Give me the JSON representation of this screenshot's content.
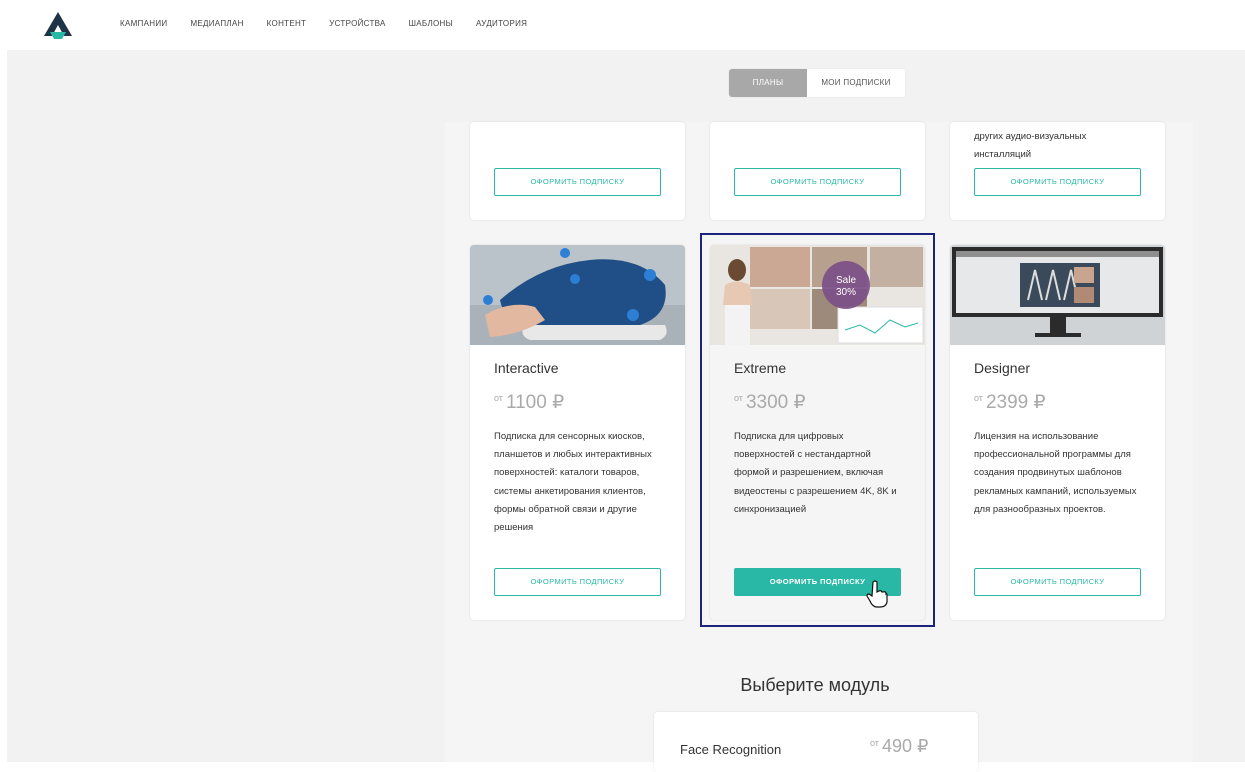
{
  "nav": {
    "items": [
      "КАМПАНИИ",
      "МЕДИАПЛАН",
      "КОНТЕНТ",
      "УСТРОЙСТВА",
      "ШАБЛОНЫ",
      "АУДИТОРИЯ"
    ]
  },
  "tabs": {
    "plans": "ПЛАНЫ",
    "my_subscriptions": "МОИ ПОДПИСКИ"
  },
  "top_cards": [
    {
      "text": "",
      "button": "ОФОРМИТЬ ПОДПИСКУ"
    },
    {
      "text": "",
      "button": "ОФОРМИТЬ ПОДПИСКУ"
    },
    {
      "text": "других аудио-визуальных инсталляций",
      "button": "ОФОРМИТЬ ПОДПИСКУ"
    }
  ],
  "plans": [
    {
      "title": "Interactive",
      "price_prefix": "от",
      "price": "1100 ₽",
      "description": "Подписка для сенсорных киосков, планшетов и любых интерактивных поверхностей: каталоги товаров, системы анкетирования клиентов, формы обратной связи и другие решения",
      "button": "ОФОРМИТЬ ПОДПИСКУ",
      "image_icon": "sneaker-touch-image"
    },
    {
      "title": "Extreme",
      "price_prefix": "от",
      "price": "3300 ₽",
      "description": "Подписка для цифровых поверхностей с нестандартной формой и разрешением, включая видеостены с разрешением 4K, 8K и синхронизацией",
      "button": "ОФОРМИТЬ ПОДПИСКУ",
      "image_icon": "videowall-image",
      "sale_badge_line1": "Sale",
      "sale_badge_line2": "30%"
    },
    {
      "title": "Designer",
      "price_prefix": "от",
      "price": "2399 ₽",
      "description": "Лицензия на использование профессиональной программы для создания продвинутых шаблонов рекламных кампаний, используемых для разнообразных проектов.",
      "button": "ОФОРМИТЬ ПОДПИСКУ",
      "image_icon": "monitor-software-image"
    }
  ],
  "modules": {
    "title": "Выберите модуль",
    "items": [
      {
        "name": "Face Recognition",
        "price_prefix": "от",
        "price": "490 ₽"
      }
    ]
  },
  "colors": {
    "accent": "#2ab8a6",
    "highlight_border": "#1a237e",
    "tab_active": "#a8a8a8"
  }
}
